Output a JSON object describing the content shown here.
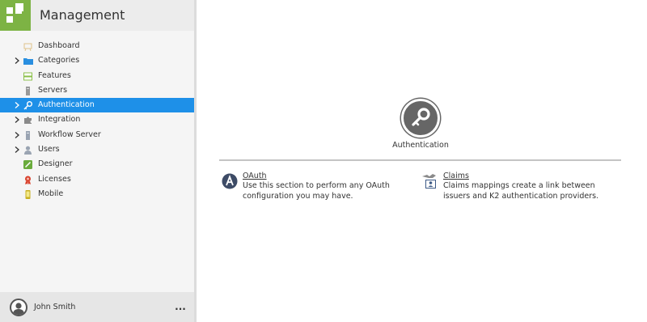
{
  "app": {
    "title": "Management"
  },
  "nav": {
    "items": [
      {
        "label": "Dashboard",
        "icon": "dashboard-icon",
        "expandable": false,
        "active": false
      },
      {
        "label": "Categories",
        "icon": "folder-icon",
        "expandable": true,
        "active": false
      },
      {
        "label": "Features",
        "icon": "features-icon",
        "expandable": false,
        "active": false
      },
      {
        "label": "Servers",
        "icon": "server-icon",
        "expandable": false,
        "active": false
      },
      {
        "label": "Authentication",
        "icon": "key-icon",
        "expandable": true,
        "active": true
      },
      {
        "label": "Integration",
        "icon": "puzzle-icon",
        "expandable": true,
        "active": false
      },
      {
        "label": "Workflow Server",
        "icon": "workflow-server-icon",
        "expandable": true,
        "active": false
      },
      {
        "label": "Users",
        "icon": "user-icon",
        "expandable": true,
        "active": false
      },
      {
        "label": "Designer",
        "icon": "designer-icon",
        "expandable": false,
        "active": false
      },
      {
        "label": "Licenses",
        "icon": "license-icon",
        "expandable": false,
        "active": false
      },
      {
        "label": "Mobile",
        "icon": "mobile-icon",
        "expandable": false,
        "active": false
      }
    ]
  },
  "footer": {
    "user_name": "John Smith",
    "more_label": "..."
  },
  "main": {
    "heading": "Authentication",
    "hero_icon": "key-icon",
    "cards": [
      {
        "title": "OAuth",
        "description": "Use this section to perform any OAuth configuration you may have.",
        "icon": "oauth-icon"
      },
      {
        "title": "Claims",
        "description": "Claims mappings create a link between issuers and K2 authentication providers.",
        "icon": "claims-icon"
      }
    ]
  },
  "colors": {
    "brand": "#7db344",
    "active": "#1e90e8",
    "sidebar": "#f5f5f5",
    "hero": "#666666"
  }
}
